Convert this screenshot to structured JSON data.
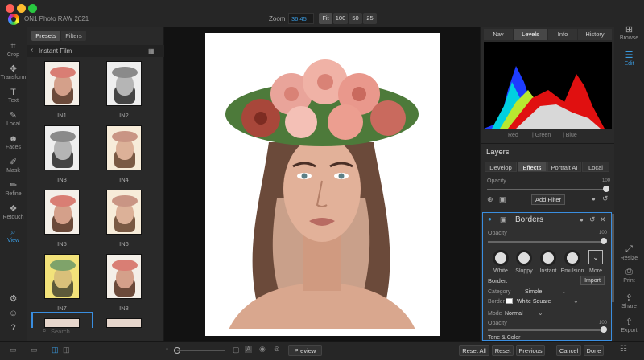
{
  "window": {
    "title": "ON1 Photo RAW 2021",
    "traffic_lights": [
      "#ff5f57",
      "#febc2e",
      "#28c840"
    ]
  },
  "zoom": {
    "label": "Zoom",
    "value": "36.45",
    "buttons": [
      "Fit",
      "100",
      "50",
      "25"
    ]
  },
  "tools": [
    {
      "label": "Crop",
      "icon": "crop-icon",
      "glyph": "⌗"
    },
    {
      "label": "Transform",
      "icon": "transform-icon",
      "glyph": "✥"
    },
    {
      "label": "Text",
      "icon": "text-icon",
      "glyph": "T"
    },
    {
      "label": "Local",
      "icon": "brush-icon",
      "glyph": "✎"
    },
    {
      "label": "Faces",
      "icon": "faces-icon",
      "glyph": "☻"
    },
    {
      "label": "Mask",
      "icon": "mask-icon",
      "glyph": "✐"
    },
    {
      "label": "Refine",
      "icon": "refine-icon",
      "glyph": "✏"
    },
    {
      "label": "Retouch",
      "icon": "retouch-icon",
      "glyph": "❖"
    },
    {
      "label": "View",
      "icon": "view-icon",
      "glyph": "⌕"
    }
  ],
  "presets": {
    "tabs": [
      "Presets",
      "Filters"
    ],
    "category": "Instant Film",
    "search_placeholder": "Search",
    "items": [
      {
        "label": "IN1",
        "tone": "color"
      },
      {
        "label": "IN2",
        "tone": "gray"
      },
      {
        "label": "IN3",
        "tone": "gray"
      },
      {
        "label": "IN4",
        "tone": "warm"
      },
      {
        "label": "IN5",
        "tone": "color"
      },
      {
        "label": "IN6",
        "tone": "warm"
      },
      {
        "label": "IN7",
        "tone": "yellow"
      },
      {
        "label": "IN8",
        "tone": "color"
      }
    ]
  },
  "right_tabs": [
    "Nav",
    "Levels",
    "Info",
    "History"
  ],
  "histogram_channels": [
    "Red",
    "| Green",
    "| Blue"
  ],
  "layers": {
    "title": "Layers",
    "tabs": [
      "Develop",
      "Effects",
      "Portrait AI",
      "Local"
    ],
    "opacity_label": "Opacity",
    "opacity_value": "100",
    "add_filter": "Add Filter"
  },
  "borders": {
    "title": "Borders",
    "opacity_label": "Opacity",
    "opacity_value": "100",
    "styles": [
      "White",
      "Sloppy",
      "Instant",
      "Emulsion",
      "More"
    ],
    "border_label": "Border:",
    "import": "Import",
    "category_label": "Category",
    "category_value": "Simple",
    "border_field_label": "Border",
    "border_value": "White Square",
    "mode_label": "Mode",
    "mode_value": "Normal",
    "opacity2_label": "Opacity",
    "opacity2_value": "100",
    "tone_color": "Tone & Color"
  },
  "right_strip": [
    {
      "label": "Browse",
      "icon": "browse-icon",
      "glyph": "⊞"
    },
    {
      "label": "Edit",
      "icon": "edit-icon",
      "glyph": "☰"
    },
    {
      "label": "Resize",
      "icon": "resize-icon",
      "glyph": "⤢"
    },
    {
      "label": "Print",
      "icon": "print-icon",
      "glyph": "⎙"
    },
    {
      "label": "Share",
      "icon": "share-icon",
      "glyph": "⇪"
    },
    {
      "label": "Export",
      "icon": "export-icon",
      "glyph": "⇧"
    }
  ],
  "bottom": {
    "preview": "Preview",
    "reset_all": "Reset All",
    "reset": "Reset",
    "previous": "Previous",
    "cancel": "Cancel",
    "done": "Done"
  },
  "colors": {
    "accent": "#3a9be0",
    "panel": "#2a2a2a",
    "canvas": "#121212"
  }
}
